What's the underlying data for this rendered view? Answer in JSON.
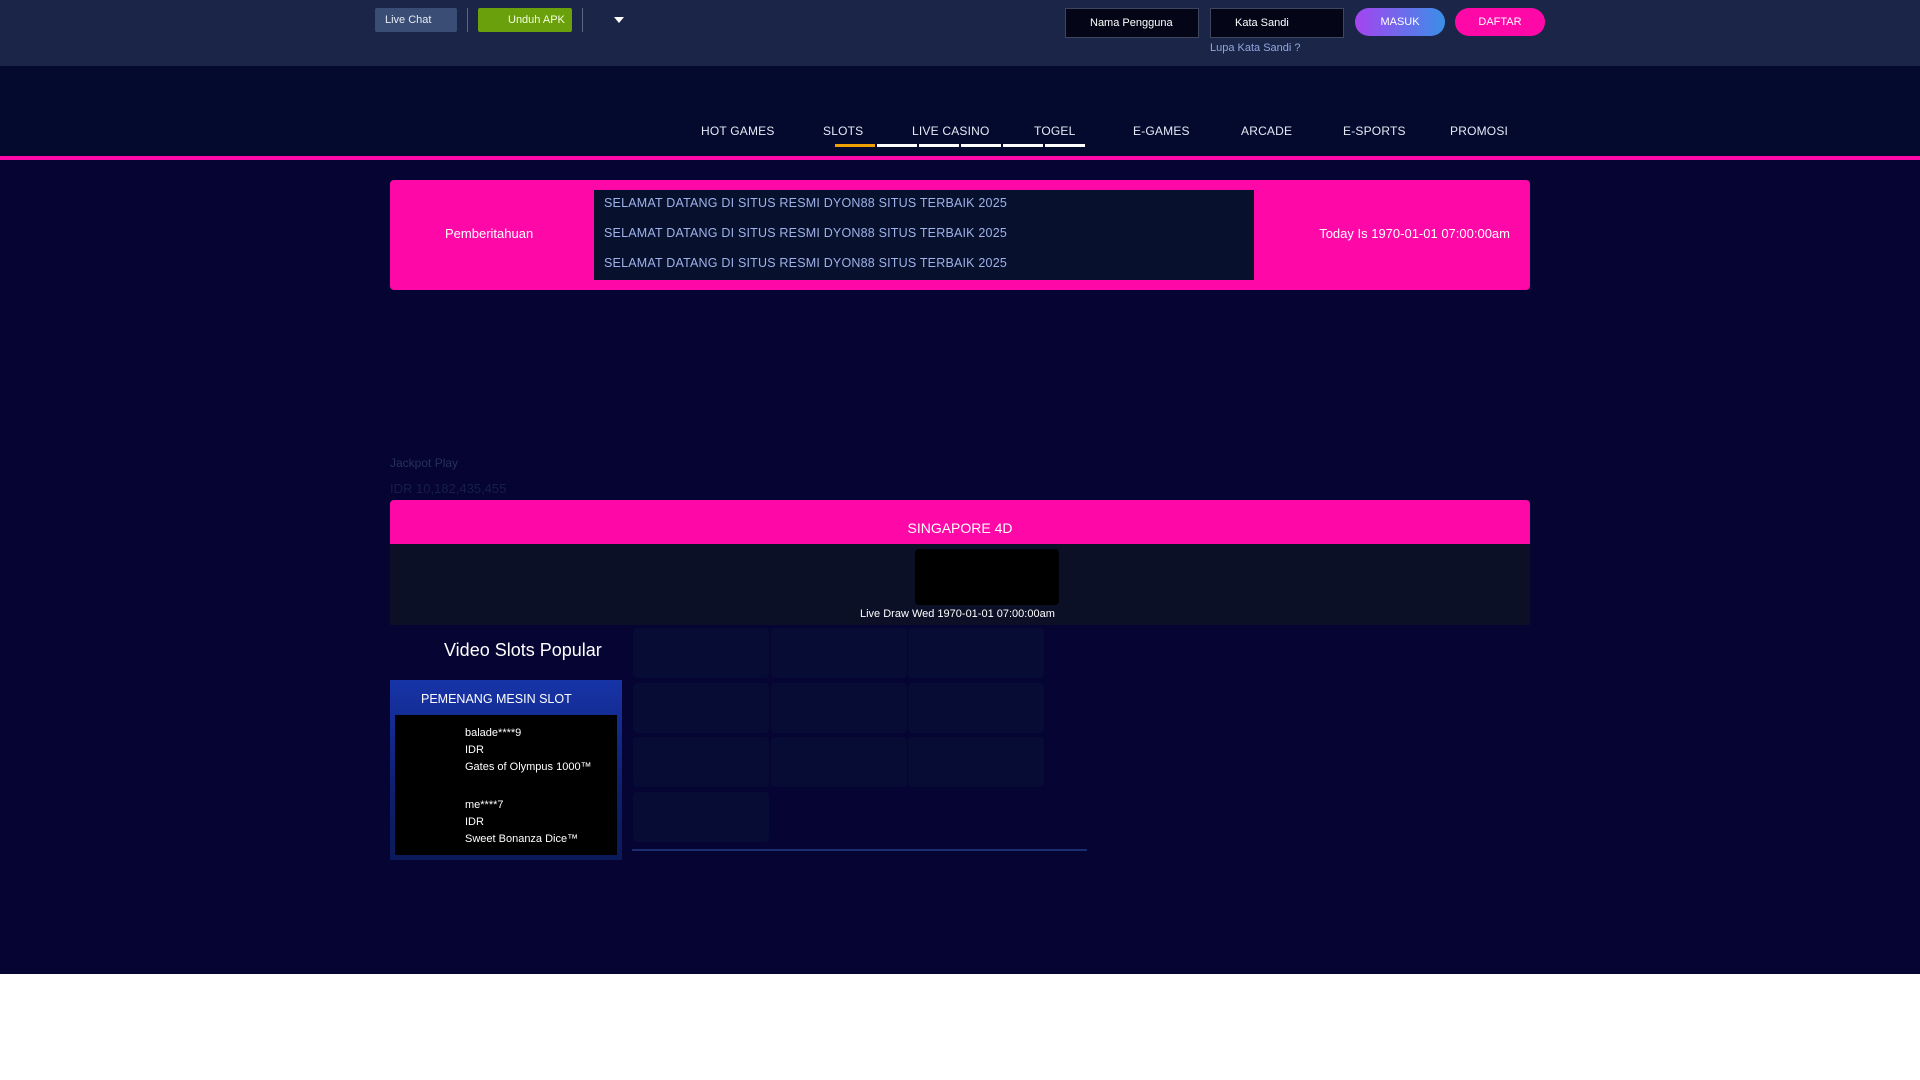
{
  "topbar": {
    "live_chat": "Live Chat",
    "download_apk": "Unduh APK",
    "username_placeholder": "Nama Pengguna",
    "password_placeholder": "Kata Sandi",
    "login": "MASUK",
    "register": "DAFTAR",
    "forgot": "Lupa Kata Sandi ?"
  },
  "nav": {
    "items": [
      "HOT GAMES",
      "SLOTS",
      "LIVE CASINO",
      "TOGEL",
      "E-GAMES",
      "ARCADE",
      "E-SPORTS",
      "PROMOSI"
    ],
    "active": "SLOTS"
  },
  "announcement": {
    "label": "Pemberitahuan",
    "lines": [
      "SELAMAT DATANG DI SITUS RESMI DYON88 SITUS TERBAIK 2025",
      "SELAMAT DATANG DI SITUS RESMI DYON88 SITUS TERBAIK 2025",
      "SELAMAT DATANG DI SITUS RESMI DYON88 SITUS TERBAIK 2025"
    ],
    "today": "Today Is 1970-01-01 07:00:00am"
  },
  "jackpot": {
    "label_a": "Jackpot",
    "label_b": "Play",
    "amount": "IDR 10,182,435,455"
  },
  "lottery": {
    "title": "SINGAPORE 4D",
    "draw": "Live Draw Wed 1970-01-01 07:00:00am"
  },
  "popular": {
    "title": "Video Slots Popular",
    "winners_title": "PEMENANG MESIN SLOT",
    "winners": [
      {
        "user": "balade****9",
        "currency": "IDR",
        "game": "Gates of Olympus 1000™"
      },
      {
        "user": "me****7",
        "currency": "IDR",
        "game": "Sweet Bonanza Dice™"
      }
    ]
  },
  "colors": {
    "accent_pink": "#ff08a8",
    "nav_active": "#f0a000",
    "background": "#050433"
  }
}
